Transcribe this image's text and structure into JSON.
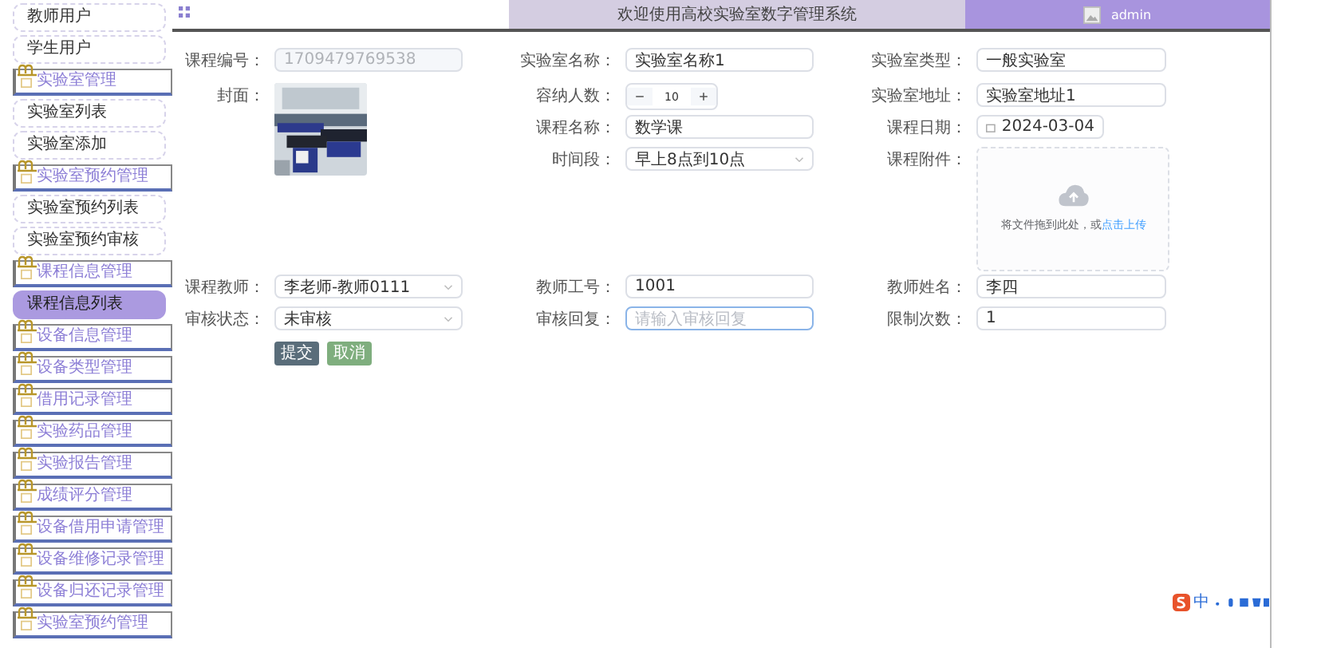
{
  "header": {
    "title": "欢迎使用高校实验室数字管理系统",
    "user": "admin"
  },
  "sidebar": {
    "items": [
      {
        "label": "教师用户",
        "kind": "link",
        "selected": false
      },
      {
        "label": "学生用户",
        "kind": "link",
        "selected": false
      },
      {
        "label": "实验室管理",
        "kind": "group",
        "selected": false
      },
      {
        "label": "实验室列表",
        "kind": "link",
        "selected": false
      },
      {
        "label": "实验室添加",
        "kind": "link",
        "selected": false
      },
      {
        "label": "实验室预约管理",
        "kind": "group",
        "selected": false
      },
      {
        "label": "实验室预约列表",
        "kind": "link",
        "selected": false
      },
      {
        "label": "实验室预约审核",
        "kind": "link",
        "selected": false
      },
      {
        "label": "课程信息管理",
        "kind": "group",
        "selected": false
      },
      {
        "label": "课程信息列表",
        "kind": "link",
        "selected": true
      },
      {
        "label": "设备信息管理",
        "kind": "group",
        "selected": false
      },
      {
        "label": "设备类型管理",
        "kind": "group",
        "selected": false
      },
      {
        "label": "借用记录管理",
        "kind": "group",
        "selected": false
      },
      {
        "label": "实验药品管理",
        "kind": "group",
        "selected": false
      },
      {
        "label": "实验报告管理",
        "kind": "group",
        "selected": false
      },
      {
        "label": "成绩评分管理",
        "kind": "group",
        "selected": false
      },
      {
        "label": "设备借用申请管理",
        "kind": "group",
        "selected": false
      },
      {
        "label": "设备维修记录管理",
        "kind": "group",
        "selected": false
      },
      {
        "label": "设备归还记录管理",
        "kind": "group",
        "selected": false
      },
      {
        "label": "实验室预约管理",
        "kind": "group",
        "selected": false
      }
    ]
  },
  "form": {
    "rows": [
      [
        {
          "label": "课程编号：",
          "kind": "input",
          "value": "1709479769538",
          "disabled": true
        },
        {
          "label": "实验室名称：",
          "kind": "input",
          "value": "实验室名称1",
          "disabled": false
        },
        {
          "label": "实验室类型：",
          "kind": "input",
          "value": "一般实验室",
          "disabled": false
        }
      ],
      [
        {
          "label": "封面："
        },
        {
          "label": "容纳人数：",
          "kind": "number",
          "value": "10"
        },
        {
          "label": "实验室地址：",
          "kind": "input",
          "value": "实验室地址1",
          "disabled": false
        }
      ],
      [
        {
          "label": "课程名称：",
          "kind": "input",
          "value": "数学课",
          "disabled": false
        },
        {
          "label": "课程日期：",
          "kind": "date",
          "value": "2024-03-04"
        }
      ],
      [
        {
          "label": "时间段：",
          "kind": "select",
          "value": "早上8点到10点"
        },
        {
          "label": "课程附件：",
          "kind": "upload",
          "hint": "将文件拖到此处，或",
          "link": "点击上传"
        }
      ],
      [
        {
          "label": "课程教师：",
          "kind": "select",
          "value": "李老师-教师0111"
        },
        {
          "label": "教师工号：",
          "kind": "input",
          "value": "1001",
          "disabled": false
        },
        {
          "label": "教师姓名：",
          "kind": "input",
          "value": "李四",
          "disabled": false
        }
      ],
      [
        {
          "label": "审核状态：",
          "kind": "select",
          "value": "未审核"
        },
        {
          "label": "审核回复：",
          "kind": "input",
          "placeholder": "请输入审核回复",
          "disabled": false,
          "focused": true
        },
        {
          "label": "限制次数：",
          "kind": "input",
          "value": "1",
          "disabled": false
        }
      ]
    ],
    "buttons": [
      {
        "label": "提交",
        "kind": "primary"
      },
      {
        "label": "取消",
        "kind": "secondary"
      }
    ]
  },
  "ime": {
    "mode": "中"
  }
}
